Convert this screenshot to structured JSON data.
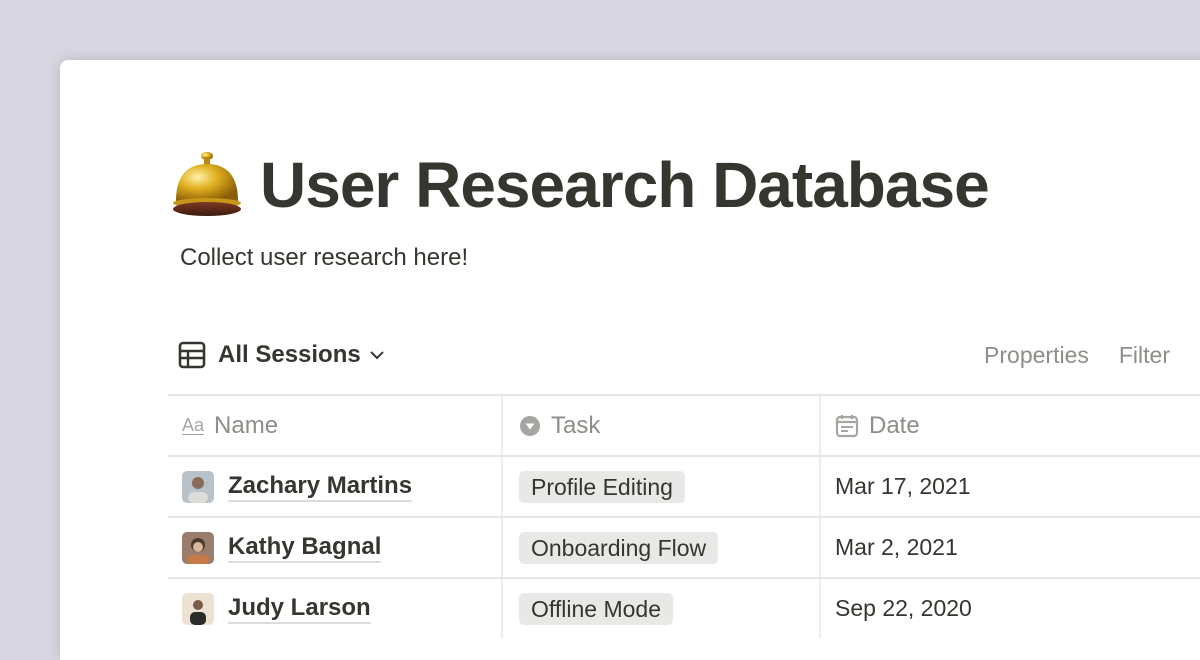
{
  "page": {
    "icon": "bellhop-bell-icon",
    "title": "User Research Database",
    "description": "Collect user research here!"
  },
  "view": {
    "icon": "table-icon",
    "name": "All Sessions",
    "actions": [
      "Properties",
      "Filter"
    ]
  },
  "table": {
    "columns": [
      {
        "icon": "text-property-icon",
        "icon_glyph": "Aa",
        "label": "Name"
      },
      {
        "icon": "select-property-icon",
        "label": "Task"
      },
      {
        "icon": "calendar-icon",
        "label": "Date"
      }
    ],
    "rows": [
      {
        "name": "Zachary Martins",
        "task": "Profile Editing",
        "date": "Mar 17, 2021",
        "avatar_colors": [
          "#a9b5bd",
          "#d8d4cc"
        ]
      },
      {
        "name": "Kathy Bagnal",
        "task": "Onboarding Flow",
        "date": "Mar 2, 2021",
        "avatar_colors": [
          "#8b6a58",
          "#c9824e"
        ]
      },
      {
        "name": "Judy Larson",
        "task": "Offline Mode",
        "date": "Sep 22, 2020",
        "avatar_colors": [
          "#e9dccb",
          "#2b2b2b"
        ]
      }
    ]
  },
  "colors": {
    "text": "#37352f",
    "muted": "#8e8d88",
    "tag_bg": "#e8e8e6",
    "backdrop": "#d9d8e2"
  }
}
